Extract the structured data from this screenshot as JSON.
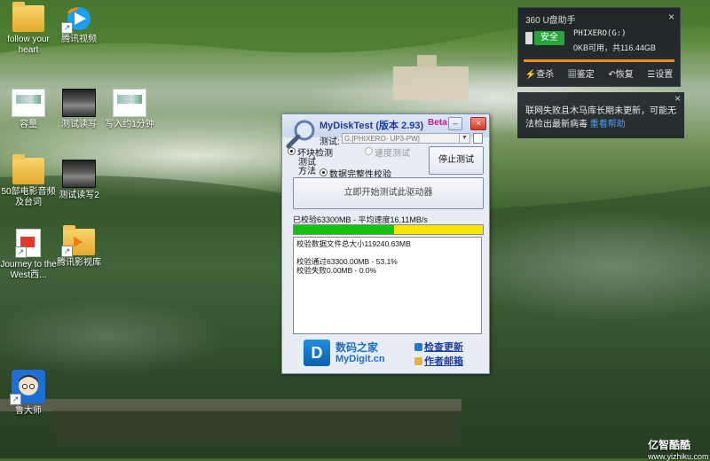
{
  "desktop": {
    "icons": [
      {
        "label": "follow your heart"
      },
      {
        "label": "腾讯视频"
      },
      {
        "label": "容量"
      },
      {
        "label": "测试读写"
      },
      {
        "label": "写入约1分钟"
      },
      {
        "label": "50部电影音频及台词"
      },
      {
        "label": "测试读写2"
      },
      {
        "label": "Journey to the West西..."
      },
      {
        "label": "腾讯影视库"
      },
      {
        "label": "鲁大师"
      }
    ]
  },
  "panel360": {
    "title": "360 U盘助手",
    "close": "×",
    "safe_label": "安全",
    "drive_name": "PHIXERO(G:)",
    "drive_info": "0KB可用，共116.44GB",
    "actions": [
      "查杀",
      "鉴定",
      "恢复",
      "设置"
    ]
  },
  "notification": {
    "text": "联网失败且木马库长期未更新，可能无法检出最新病毒",
    "link": "重看帮助",
    "close": "×"
  },
  "app": {
    "title": "MyDiskTest",
    "version": "(版本 2.93)",
    "beta": "Beta",
    "drive_label": "测试:",
    "drive_value": "G:[PHIXERO- UP3-PW]",
    "mode_bad_block": "坏块检测",
    "mode_speed": "速度测试",
    "method_label": "测试方法",
    "method_value": "数据完整性校验",
    "stop_button": "停止测试",
    "start_button": "立即开始测试此驱动器",
    "status": "已校验63300MB - 平均速度16.11MB/s",
    "progress_fraction": 0.531,
    "log": [
      "校验数据文件总大小119240.63MB",
      "",
      "校验通过63300.00MB - 53.1%",
      "校验失败0.00MB - 0.0%"
    ],
    "footer": {
      "logo": "D",
      "brand_cn": "数码之家",
      "brand_en": "MyDigit.cn",
      "check_update": "检查更新",
      "author_email": "作者邮箱"
    }
  },
  "watermark": {
    "brand": "亿智酷酷",
    "url": "www.yizhiku.com"
  }
}
